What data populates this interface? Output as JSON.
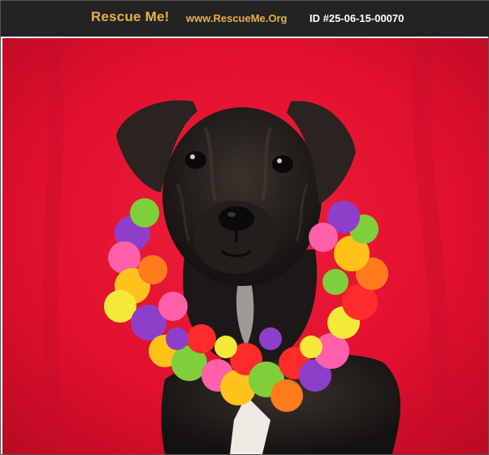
{
  "header": {
    "brand": "Rescue Me!",
    "site": "www.RescueMe.Org",
    "pet_id": "ID #25-06-15-00070"
  },
  "photo": {
    "subject_icon": "puppy-with-flower-lei",
    "background_color": "#e0102e",
    "fur_color": "#1c1818"
  },
  "colors": {
    "header_bg": "#232323",
    "brand_accent": "#e8b04a"
  }
}
